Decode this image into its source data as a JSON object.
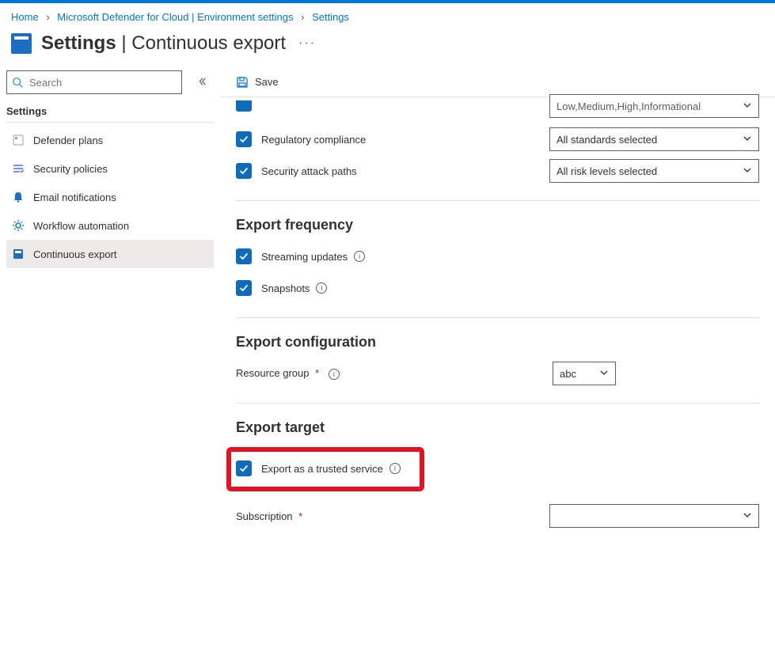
{
  "breadcrumb": {
    "home": "Home",
    "b1": "Microsoft Defender for Cloud | Environment settings",
    "b2": "Settings"
  },
  "header": {
    "title_bold": "Settings",
    "title_rest": " | Continuous export"
  },
  "sidebar": {
    "search_placeholder": "Search",
    "heading": "Settings",
    "items": [
      {
        "label": "Defender plans"
      },
      {
        "label": "Security policies"
      },
      {
        "label": "Email notifications"
      },
      {
        "label": "Workflow automation"
      },
      {
        "label": "Continuous export"
      }
    ]
  },
  "toolbar": {
    "save": "Save"
  },
  "main": {
    "truncated_select": "Low,Medium,High,Informational",
    "reg_compliance": "Regulatory compliance",
    "reg_compliance_val": "All standards selected",
    "attack_paths": "Security attack paths",
    "attack_paths_val": "All risk levels selected",
    "freq_heading": "Export frequency",
    "streaming": "Streaming updates",
    "snapshots": "Snapshots",
    "config_heading": "Export configuration",
    "resource_group_label": "Resource group",
    "resource_group_val": "abc",
    "target_heading": "Export target",
    "trusted_service": "Export as a trusted service",
    "subscription_label": "Subscription"
  }
}
